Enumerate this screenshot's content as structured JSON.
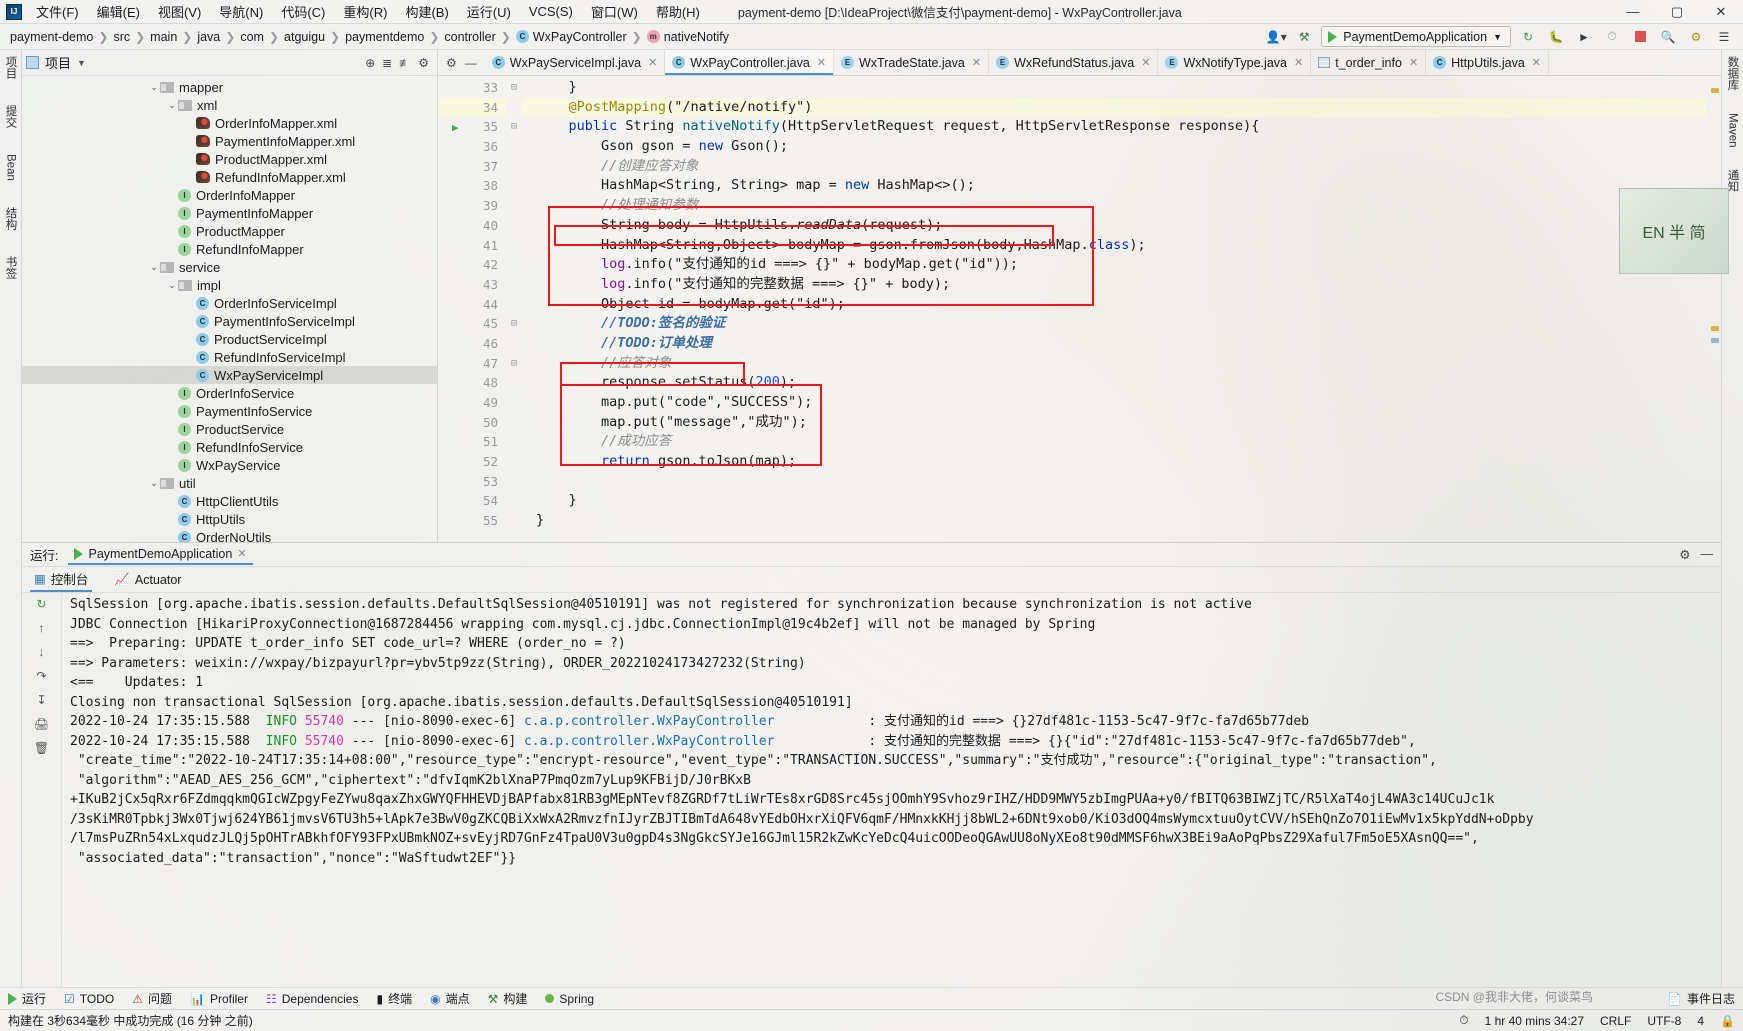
{
  "titlebar": {
    "menus": [
      "文件(F)",
      "编辑(E)",
      "视图(V)",
      "导航(N)",
      "代码(C)",
      "重构(R)",
      "构建(B)",
      "运行(U)",
      "VCS(S)",
      "窗口(W)",
      "帮助(H)"
    ],
    "window_title": "payment-demo [D:\\IdeaProject\\微信支付\\payment-demo] - WxPayController.java",
    "minimize": "—",
    "maximize": "▢",
    "close": "✕"
  },
  "breadcrumb": {
    "items": [
      {
        "label": "payment-demo",
        "badge": ""
      },
      {
        "label": "src",
        "badge": ""
      },
      {
        "label": "main",
        "badge": ""
      },
      {
        "label": "java",
        "badge": ""
      },
      {
        "label": "com",
        "badge": ""
      },
      {
        "label": "atguigu",
        "badge": ""
      },
      {
        "label": "paymentdemo",
        "badge": ""
      },
      {
        "label": "controller",
        "badge": ""
      },
      {
        "label": "WxPayController",
        "badge": "C"
      },
      {
        "label": "nativeNotify",
        "badge": "m"
      }
    ],
    "run_config": "PaymentDemoApplication",
    "icons": [
      "user-icon",
      "hammer-icon",
      "rerun-icon",
      "debug-icon",
      "coverage-icon",
      "profiler-icon",
      "stop-icon",
      "search-icon",
      "plugin-icon",
      "settings-icon"
    ]
  },
  "project_panel": {
    "title": "项目",
    "toolbar_icons": [
      "locate-icon",
      "expand-all-icon",
      "collapse-all-icon",
      "settings-icon"
    ],
    "tree": [
      {
        "indent": 1,
        "chev": "⌄",
        "icon": "folder",
        "label": "mapper"
      },
      {
        "indent": 2,
        "chev": "⌄",
        "icon": "folder",
        "label": "xml"
      },
      {
        "indent": 3,
        "chev": "",
        "icon": "xml",
        "label": "OrderInfoMapper.xml"
      },
      {
        "indent": 3,
        "chev": "",
        "icon": "xml",
        "label": "PaymentInfoMapper.xml"
      },
      {
        "indent": 3,
        "chev": "",
        "icon": "xml",
        "label": "ProductMapper.xml"
      },
      {
        "indent": 3,
        "chev": "",
        "icon": "xml",
        "label": "RefundInfoMapper.xml"
      },
      {
        "indent": 2,
        "chev": "",
        "icon": "I",
        "label": "OrderInfoMapper"
      },
      {
        "indent": 2,
        "chev": "",
        "icon": "I",
        "label": "PaymentInfoMapper"
      },
      {
        "indent": 2,
        "chev": "",
        "icon": "I",
        "label": "ProductMapper"
      },
      {
        "indent": 2,
        "chev": "",
        "icon": "I",
        "label": "RefundInfoMapper"
      },
      {
        "indent": 1,
        "chev": "⌄",
        "icon": "folder",
        "label": "service"
      },
      {
        "indent": 2,
        "chev": "⌄",
        "icon": "folder",
        "label": "impl"
      },
      {
        "indent": 3,
        "chev": "",
        "icon": "C",
        "label": "OrderInfoServiceImpl"
      },
      {
        "indent": 3,
        "chev": "",
        "icon": "C",
        "label": "PaymentInfoServiceImpl"
      },
      {
        "indent": 3,
        "chev": "",
        "icon": "C",
        "label": "ProductServiceImpl"
      },
      {
        "indent": 3,
        "chev": "",
        "icon": "C",
        "label": "RefundInfoServiceImpl"
      },
      {
        "indent": 3,
        "chev": "",
        "icon": "C",
        "label": "WxPayServiceImpl",
        "selected": true
      },
      {
        "indent": 2,
        "chev": "",
        "icon": "I",
        "label": "OrderInfoService"
      },
      {
        "indent": 2,
        "chev": "",
        "icon": "I",
        "label": "PaymentInfoService"
      },
      {
        "indent": 2,
        "chev": "",
        "icon": "I",
        "label": "ProductService"
      },
      {
        "indent": 2,
        "chev": "",
        "icon": "I",
        "label": "RefundInfoService"
      },
      {
        "indent": 2,
        "chev": "",
        "icon": "I",
        "label": "WxPayService"
      },
      {
        "indent": 1,
        "chev": "⌄",
        "icon": "folder",
        "label": "util"
      },
      {
        "indent": 2,
        "chev": "",
        "icon": "C",
        "label": "HttpClientUtils"
      },
      {
        "indent": 2,
        "chev": "",
        "icon": "C",
        "label": "HttpUtils"
      },
      {
        "indent": 2,
        "chev": "",
        "icon": "C",
        "label": "OrderNoUtils"
      }
    ]
  },
  "editor_tabs": [
    {
      "label": "WxPayServiceImpl.java",
      "badge": "C",
      "active": false
    },
    {
      "label": "WxPayController.java",
      "badge": "C",
      "active": true
    },
    {
      "label": "WxTradeState.java",
      "badge": "E",
      "active": false
    },
    {
      "label": "WxRefundStatus.java",
      "badge": "E",
      "active": false
    },
    {
      "label": "WxNotifyType.java",
      "badge": "E",
      "active": false
    },
    {
      "label": "t_order_info",
      "badge": "T",
      "active": false
    },
    {
      "label": "HttpUtils.java",
      "badge": "C",
      "active": false
    }
  ],
  "editor": {
    "inspection_count": "3",
    "lines": [
      {
        "n": "33",
        "text": "    }"
      },
      {
        "n": "34",
        "text": "    @PostMapping(\"/native/notify\")",
        "highlight": true
      },
      {
        "n": "35",
        "text": "    public String nativeNotify(HttpServletRequest request, HttpServletResponse response){",
        "gutter_mark": "run-icon"
      },
      {
        "n": "36",
        "text": "        Gson gson = new Gson();"
      },
      {
        "n": "37",
        "text": "        //创建应答对象"
      },
      {
        "n": "38",
        "text": "        HashMap<String, String> map = new HashMap<>();"
      },
      {
        "n": "39",
        "text": "        //处理通知参数"
      },
      {
        "n": "40",
        "text": "        String body = HttpUtils.readData(request);"
      },
      {
        "n": "41",
        "text": "        HashMap<String,Object> bodyMap = gson.fromJson(body,HashMap.class);"
      },
      {
        "n": "42",
        "text": "        log.info(\"支付通知的id ===> {}\" + bodyMap.get(\"id\"));"
      },
      {
        "n": "43",
        "text": "        log.info(\"支付通知的完整数据 ===> {}\" + body);"
      },
      {
        "n": "44",
        "text": "        Object id = bodyMap.get(\"id\");"
      },
      {
        "n": "45",
        "text": "        //TODO:签名的验证"
      },
      {
        "n": "46",
        "text": "        //TODO:订单处理"
      },
      {
        "n": "47",
        "text": "        //应答对象"
      },
      {
        "n": "48",
        "text": "        response.setStatus(200);"
      },
      {
        "n": "49",
        "text": "        map.put(\"code\",\"SUCCESS\");"
      },
      {
        "n": "50",
        "text": "        map.put(\"message\",\"成功\");"
      },
      {
        "n": "51",
        "text": "        //成功应答"
      },
      {
        "n": "52",
        "text": "        return gson.toJson(map);"
      },
      {
        "n": "53",
        "text": "    "
      },
      {
        "n": "54",
        "text": "    }"
      },
      {
        "n": "55",
        "text": "}"
      }
    ],
    "annotations": [
      "red-box-outer",
      "red-box-line41",
      "red-box-setstatus",
      "red-box-maprows"
    ]
  },
  "run_window": {
    "label": "运行:",
    "config_tab": "PaymentDemoApplication",
    "subtabs": [
      {
        "label": "控制台",
        "icon": "console-icon",
        "active": true
      },
      {
        "label": "Actuator",
        "icon": "actuator-icon",
        "active": false
      }
    ],
    "gutter_icons": [
      "rerun-icon",
      "up-icon",
      "down-icon",
      "soft-wrap-icon",
      "scroll-end-icon",
      "print-icon",
      "trash-icon"
    ],
    "console_lines": [
      "SqlSession [org.apache.ibatis.session.defaults.DefaultSqlSession@40510191] was not registered for synchronization because synchronization is not active",
      "JDBC Connection [HikariProxyConnection@1687284456 wrapping com.mysql.cj.jdbc.ConnectionImpl@19c4b2ef] will not be managed by Spring",
      "==>  Preparing: UPDATE t_order_info SET code_url=? WHERE (order_no = ?)",
      "==> Parameters: weixin://wxpay/bizpayurl?pr=ybv5tp9zz(String), ORDER_20221024173427232(String)",
      "<==    Updates: 1",
      "Closing non transactional SqlSession [org.apache.ibatis.session.defaults.DefaultSqlSession@40510191]"
    ],
    "log_rows": [
      {
        "ts": "2022-10-24 17:35:15.588",
        "level": "INFO",
        "pid": "55740",
        "sep": "---",
        "thread": "[nio-8090-exec-6]",
        "logger": "c.a.p.controller.WxPayController",
        "msg": ": 支付通知的id ===> {}27df481c-1153-5c47-9f7c-fa7d65b77deb"
      },
      {
        "ts": "2022-10-24 17:35:15.588",
        "level": "INFO",
        "pid": "55740",
        "sep": "---",
        "thread": "[nio-8090-exec-6]",
        "logger": "c.a.p.controller.WxPayController",
        "msg": ": 支付通知的完整数据 ===> {}{\"id\":\"27df481c-1153-5c47-9f7c-fa7d65b77deb\","
      }
    ],
    "payload_lines": [
      " \"create_time\":\"2022-10-24T17:35:14+08:00\",\"resource_type\":\"encrypt-resource\",\"event_type\":\"TRANSACTION.SUCCESS\",\"summary\":\"支付成功\",\"resource\":{\"original_type\":\"transaction\",",
      " \"algorithm\":\"AEAD_AES_256_GCM\",\"ciphertext\":\"dfvIqmK2blXnaP7PmqOzm7yLup9KFBijD/J0rBKxB",
      "+IKuB2jCx5qRxr6FZdmqqkmQGIcWZpgyFeZYwu8qaxZhxGWYQFHHEVDjBAPfabx81RB3gMEpNTevf8ZGRDf7tLiWrTEs8xrGD8Src45sjOOmhY9Svhoz9rIHZ/HDD9MWY5zbImgPUAa+y0/fBITQ63BIWZjTC/R5lXaT4ojL4WA3c14UCuJc1k",
      "/3sKiMR0Tpbkj3Wx0Tjwj624YB61jmvsV6TU3h5+lApk7e3BwV0gZKCQBiXxWxA2RmvzfnIJyrZBJTIBmTdA648vYEdbOHxrXiQFV6qmF/HMnxkKHjj8bWL2+6DNt9xob0/KiO3dOQ4msWymcxtuuOytCVV/hSEhQnZo7O1iEwMv1x5kpYddN+oDpby",
      "/l7msPuZRn54xLxqudzJLQj5pOHTrABkhfOFY93FPxUBmkNOZ+svEyjRD7GnFz4TpaU0V3u0gpD4s3NgGkcSYJe16GJml15R2kZwKcYeDcQ4uicOODeoQGAwUU8oNyXEo8t90dMMSF6hwX3BEi9aAoPqPbsZ29Xaful7Fm5oE5XAsnQQ==\",",
      " \"associated_data\":\"transaction\",\"nonce\":\"WaSftudwt2EF\"}}"
    ]
  },
  "status_bar": {
    "run_label": "运行",
    "items": [
      {
        "label": "TODO",
        "icon": "todo-icon"
      },
      {
        "label": "问题",
        "icon": "problems-icon"
      },
      {
        "label": "Profiler",
        "icon": "profiler-icon"
      },
      {
        "label": "Dependencies",
        "icon": "dependencies-icon"
      },
      {
        "label": "终端",
        "icon": "terminal-icon"
      },
      {
        "label": "端点",
        "icon": "endpoints-icon"
      },
      {
        "label": "构建",
        "icon": "build-icon"
      },
      {
        "label": "Spring",
        "icon": "spring-icon"
      }
    ],
    "event_log": "事件日志",
    "build_message": "构建在 3秒634毫秒 中成功完成 (16 分钟 之前)",
    "timer": "1 hr 40 mins  34:27",
    "line_sep": "CRLF",
    "encoding": "UTF-8",
    "indent": "4",
    "lock_icon": "lock-icon",
    "watermark": "CSDN @我非大佬，何谈菜鸟"
  },
  "left_strip": [
    "项目",
    "提交",
    "Bean",
    "结构",
    "书签"
  ],
  "right_strip": [
    "数据库",
    "Maven",
    "通知"
  ],
  "avatar": "EN 半 简"
}
